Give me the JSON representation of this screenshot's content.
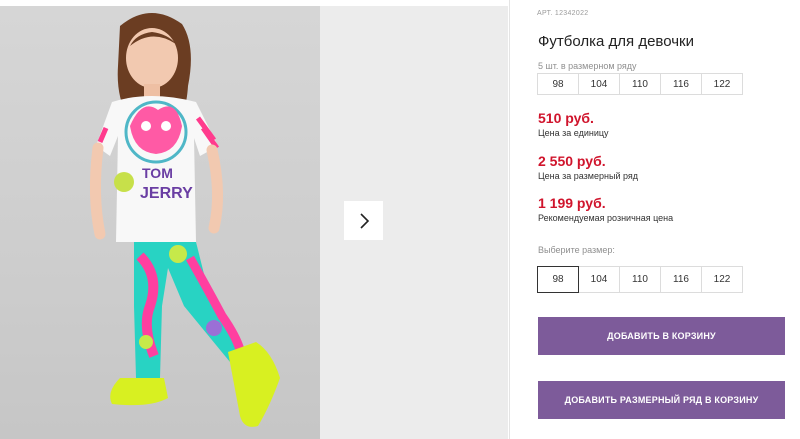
{
  "product": {
    "sku": "АРТ. 12342022",
    "title": "Футболка для девочки",
    "set_label": "5 шт. в размерном ряду",
    "set_sizes": [
      "98",
      "104",
      "110",
      "116",
      "122"
    ],
    "prices": [
      {
        "value": "510 руб.",
        "note": "Цена за единицу"
      },
      {
        "value": "2 550 руб.",
        "note": "Цена за размерный ряд"
      },
      {
        "value": "1 199 руб.",
        "note": "Рекомендуемая розничная цена"
      }
    ],
    "choose_label": "Выберите размер:",
    "sizes": [
      "98",
      "104",
      "110",
      "116",
      "122"
    ],
    "selected_size": "98"
  },
  "actions": {
    "add_to_cart": "ДОБАВИТЬ В КОРЗИНУ",
    "add_set_to_cart": "ДОБАВИТЬ РАЗМЕРНЫЙ РЯД В КОРЗИНУ"
  },
  "gallery": {
    "tshirt_print_top": "TOM",
    "tshirt_print_bottom": "JERRY"
  },
  "colors": {
    "accent_button": "#7d5b9a",
    "price_red": "#d0142c"
  },
  "icons": {
    "next": "chevron-right-icon"
  }
}
